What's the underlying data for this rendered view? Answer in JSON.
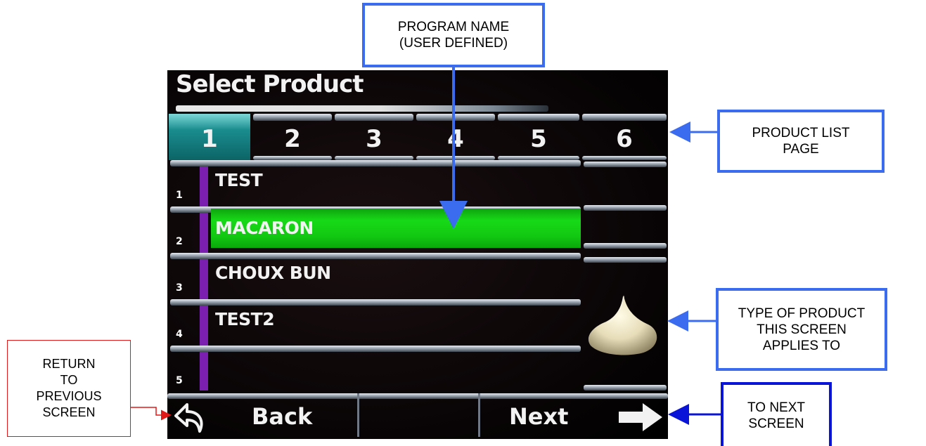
{
  "screen": {
    "title": "Select Product",
    "tabs": [
      "1",
      "2",
      "3",
      "4",
      "5",
      "6"
    ],
    "active_tab": "1",
    "rows": [
      {
        "index": "1",
        "label": "TEST"
      },
      {
        "index": "2",
        "label": "MACARON",
        "selected": true
      },
      {
        "index": "3",
        "label": "CHOUX BUN"
      },
      {
        "index": "4",
        "label": "TEST2"
      },
      {
        "index": "5",
        "label": ""
      }
    ],
    "product_type_icon": "choux-cone-icon",
    "back_label": "Back",
    "next_label": "Next"
  },
  "callouts": {
    "program_name": "PROGRAM NAME\n(USER DEFINED)",
    "product_list_page": "PRODUCT LIST\nPAGE",
    "product_type": "TYPE OF PRODUCT\nTHIS SCREEN\nAPPLIES TO",
    "return": "RETURN\nTO\nPREVIOUS\nSCREEN",
    "next": "TO NEXT\nSCREEN"
  },
  "colors": {
    "callout_blue": "#3b6cf0",
    "callout_red": "#e01818",
    "callout_navy": "#0a14d8",
    "active_tab": "#1a8c8e",
    "selected_row": "#17d917",
    "row_marker": "#7a1fb0"
  }
}
